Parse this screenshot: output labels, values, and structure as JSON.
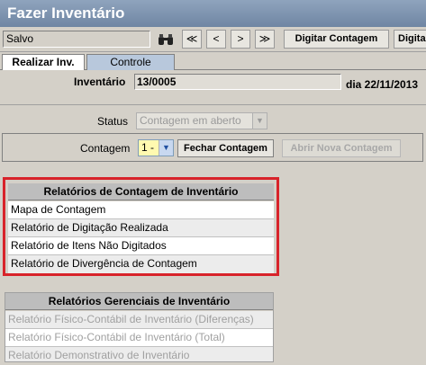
{
  "window": {
    "title": "Fazer Inventário"
  },
  "toolbar": {
    "status_value": "Salvo",
    "search_icon": "binoculars-icon",
    "nav": {
      "first": "≪",
      "prev": "<",
      "next": ">",
      "last": "≫"
    },
    "digitar_contagem_label": "Digitar Contagem",
    "digitar_cut_label": "Digita"
  },
  "tabs": [
    {
      "label": "Realizar Inv.",
      "active": true
    },
    {
      "label": "Controle",
      "active": false
    }
  ],
  "inventario": {
    "label": "Inventário",
    "value": "13/0005",
    "date": "dia 22/11/2013"
  },
  "status": {
    "label": "Status",
    "value": "Contagem em aberto"
  },
  "contagem": {
    "label": "Contagem",
    "value": "1 -",
    "fechar_label": "Fechar Contagem",
    "abrir_label": "Abrir Nova Contagem"
  },
  "relatorios_contagem": {
    "title": "Relatórios de Contagem de Inventário",
    "items": [
      "Mapa de Contagem",
      "Relatório de Digitação Realizada",
      "Relatório de Itens Não Digitados",
      "Relatório de Divergência de Contagem"
    ]
  },
  "relatorios_gerenciais": {
    "title": "Relatórios Gerenciais de Inventário",
    "items": [
      "Relatório Físico-Contábil de Inventário (Diferenças)",
      "Relatório Físico-Contábil de Inventário (Total)",
      "Relatório Demonstrativo de Inventário"
    ]
  },
  "colors": {
    "highlight_border": "#d8232a",
    "title_bar": "#7b90ac",
    "contagem_field": "#fff9b0"
  }
}
